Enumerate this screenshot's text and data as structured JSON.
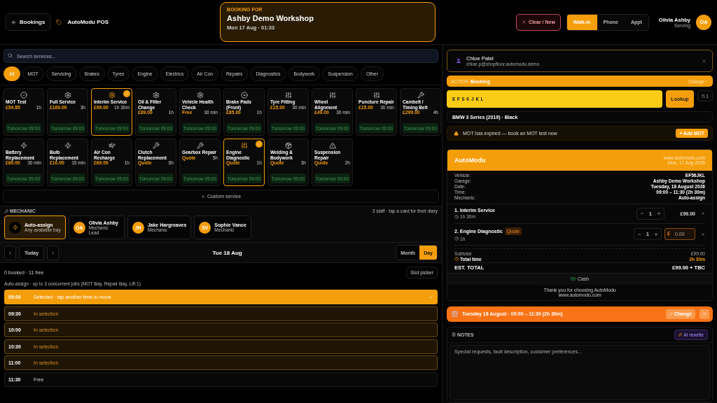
{
  "header": {
    "back_label": "Bookings",
    "app_name": "AutoModu POS",
    "booking_for": {
      "label": "BOOKING FOR",
      "workshop": "Ashby Demo Workshop",
      "datetime": "Mon 17 Aug · 01:33"
    },
    "clear_label": "Clear / New",
    "channels": [
      {
        "label": "Walk-in",
        "selected": true
      },
      {
        "label": "Phone",
        "selected": false
      },
      {
        "label": "Appt",
        "selected": false
      }
    ],
    "user": {
      "name": "Olivia Ashby",
      "role": "Serving",
      "initials": "OA"
    }
  },
  "search": {
    "placeholder": "Search services..."
  },
  "categories": [
    {
      "label": "All",
      "selected": true
    },
    {
      "label": "MOT",
      "selected": false
    },
    {
      "label": "Servicing",
      "selected": false
    },
    {
      "label": "Brakes",
      "selected": false
    },
    {
      "label": "Tyres",
      "selected": false
    },
    {
      "label": "Engine",
      "selected": false
    },
    {
      "label": "Electrics",
      "selected": false
    },
    {
      "label": "Air Con",
      "selected": false
    },
    {
      "label": "Repairs",
      "selected": false
    },
    {
      "label": "Diagnostics",
      "selected": false
    },
    {
      "label": "Bodywork",
      "selected": false
    },
    {
      "label": "Suspension",
      "selected": false
    },
    {
      "label": "Other",
      "selected": false
    }
  ],
  "services": [
    {
      "name": "MOT Test",
      "price": "£54.85",
      "duration": "1h",
      "slot": "Tomorrow 09:00",
      "selected": false
    },
    {
      "name": "Full Service",
      "price": "£169.00",
      "duration": "3h",
      "slot": "Tomorrow 09:00",
      "selected": false
    },
    {
      "name": "Interim Service",
      "price": "£99.00",
      "duration": "1h 30m",
      "slot": "Tomorrow 09:00",
      "selected": true
    },
    {
      "name": "Oil & Filter Change",
      "price": "£89.00",
      "duration": "1h",
      "slot": "Tomorrow 09:00",
      "selected": false
    },
    {
      "name": "Vehicle Health Check",
      "price": "Free",
      "duration": "30 min",
      "slot": "Tomorrow 09:00",
      "selected": false
    },
    {
      "name": "Brake Pads (Front)",
      "price": "£85.00",
      "duration": "1h",
      "slot": "Tomorrow 09:00",
      "selected": false
    },
    {
      "name": "Tyre Fitting",
      "price": "£15.00",
      "duration": "30 min",
      "slot": "Tomorrow 09:00",
      "selected": false
    },
    {
      "name": "Wheel Alignment",
      "price": "£49.00",
      "duration": "30 min",
      "slot": "Tomorrow 09:00",
      "selected": false
    },
    {
      "name": "Puncture Repair",
      "price": "£15.00",
      "duration": "30 min",
      "slot": "Tomorrow 09:00",
      "selected": false
    },
    {
      "name": "Cambelt / Timing Belt",
      "price": "£299.00",
      "duration": "4h",
      "slot": "Tomorrow 09:00",
      "selected": false
    },
    {
      "name": "Battery Replacement",
      "price": "£89.00",
      "duration": "30 min",
      "slot": "Tomorrow 09:00",
      "selected": false
    },
    {
      "name": "Bulb Replacement",
      "price": "£10.00",
      "duration": "15 min",
      "slot": "Tomorrow 09:00",
      "selected": false
    },
    {
      "name": "Air Con Recharge",
      "price": "£69.00",
      "duration": "1h",
      "slot": "Tomorrow 09:00",
      "selected": false
    },
    {
      "name": "Clutch Replacement",
      "price": "Quote",
      "duration": "6h",
      "slot": "Tomorrow 09:00",
      "selected": false
    },
    {
      "name": "Gearbox Repair",
      "price": "Quote",
      "duration": "5h",
      "slot": "Tomorrow 09:00",
      "selected": false
    },
    {
      "name": "Engine Diagnostic",
      "price": "Quote",
      "duration": "1h",
      "slot": "Tomorrow 09:00",
      "selected": true
    },
    {
      "name": "Welding & Bodywork",
      "price": "Quote",
      "duration": "3h",
      "slot": "Tomorrow 09:00",
      "selected": false
    },
    {
      "name": "Suspension Repair",
      "price": "Quote",
      "duration": "2h",
      "slot": "Tomorrow 09:00",
      "selected": false
    }
  ],
  "custom_service": "Custom service",
  "mechanic": {
    "title": "MECHANIC",
    "hint": "3 staff · tap a card for their diary",
    "options": [
      {
        "kind": "auto",
        "name": "Auto-assign",
        "subtitle": "Any available bay",
        "selected": true
      },
      {
        "kind": "staff",
        "initials": "OA",
        "name": "Olivia Ashby",
        "subtitle": "Mechanic",
        "tag": "Lead",
        "selected": false
      },
      {
        "kind": "staff",
        "initials": "JH",
        "name": "Jake Hargreaves",
        "subtitle": "Mechanic",
        "selected": false
      },
      {
        "kind": "staff",
        "initials": "SV",
        "name": "Sophie Vance",
        "subtitle": "Mechanic",
        "selected": false
      }
    ]
  },
  "calendar": {
    "today": "Today",
    "date": "Tue 18 Aug",
    "views": [
      {
        "label": "Month",
        "selected": false
      },
      {
        "label": "Day",
        "selected": true
      }
    ],
    "summary": "0 booked · 11 free",
    "slot_picker": "Slot picker",
    "note": "Auto-assign · up to 3 concurrent jobs (MOT Bay, Repair Bay, Lift 1)",
    "slots": [
      {
        "time": "09:00",
        "label": "Selected · tap another time to move",
        "kind": "selected"
      },
      {
        "time": "09:30",
        "label": "In selection",
        "kind": "range"
      },
      {
        "time": "10:00",
        "label": "In selection",
        "kind": "range"
      },
      {
        "time": "10:30",
        "label": "In selection",
        "kind": "range"
      },
      {
        "time": "11:00",
        "label": "In selection",
        "kind": "range"
      },
      {
        "time": "11:30",
        "label": "Free",
        "kind": "free"
      }
    ]
  },
  "customer": {
    "name": "Chloe Patel",
    "email": "chloe.p@shopfloor.automodu.demo"
  },
  "action": {
    "label": "ACTION",
    "value": "Booking",
    "change": "Change"
  },
  "vehicle": {
    "plate": "EF56JKL",
    "lookup": "Lookup",
    "count": "1",
    "description": "BMW 3 Series (2019) · Black"
  },
  "mot_alert": {
    "text": "MOT has expired — book an MOT test now",
    "action": "+ Add MOT"
  },
  "receipt": {
    "brand": "AutoModu",
    "website": "www.automodu.com",
    "date": "Mon, 17 Aug 2026",
    "details": [
      {
        "label": "Vehicle:",
        "value": "EF56JKL"
      },
      {
        "label": "Garage:",
        "value": "Ashby Demo Workshop"
      },
      {
        "label": "Date:",
        "value": "Tuesday, 18 August 2026"
      },
      {
        "label": "Time:",
        "value": "09:00 – 11:30 (2h 30m)"
      },
      {
        "label": "Mechanic:",
        "value": "Auto-assign"
      }
    ],
    "items": [
      {
        "kind": "fixed",
        "name": "1. Interim Service",
        "duration": "1h 30m",
        "qty": "1",
        "price": "£99.00"
      },
      {
        "kind": "quote",
        "name": "2. Engine Diagnostic",
        "tag": "Quote",
        "duration": "1h",
        "qty": "1",
        "currency": "£",
        "placeholder": "0.00"
      }
    ],
    "subtotal_label": "Subtotal",
    "subtotal": "£99.00",
    "total_time_label": "Total time",
    "total_time": "2h 30m",
    "est_label": "EST. TOTAL",
    "est": "£99.00 + TBC",
    "payment": "Cash",
    "thanks": "Thank you for choosing AutoModu",
    "thanks_url": "www.automodu.com"
  },
  "booking_bar": {
    "text": "Tuesday 18 August · 09:00 – 11:30 (2h 30m)",
    "change": "Change"
  },
  "notes": {
    "title": "NOTES",
    "ai": "AI rewrite",
    "placeholder": "Special requests, fault description, customer preferences..."
  }
}
